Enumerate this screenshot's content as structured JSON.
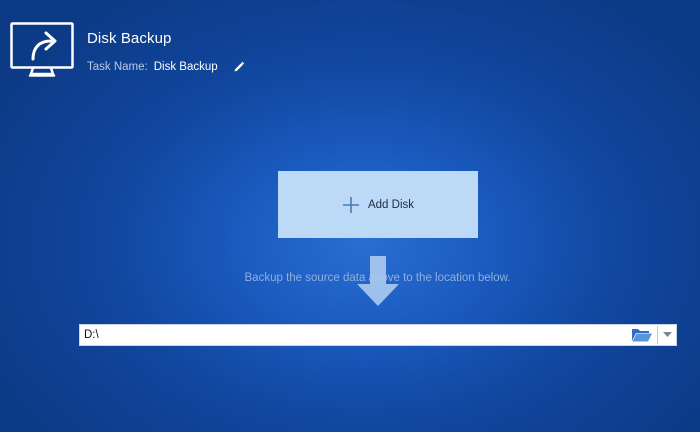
{
  "header": {
    "title": "Disk Backup",
    "task_label": "Task Name:",
    "task_value": "Disk Backup",
    "icon": "backup-monitor-icon",
    "edit_icon": "pencil-icon"
  },
  "source": {
    "add_label": "Add Disk",
    "icon": "plus-icon"
  },
  "hint": "Backup the source data above to the location below.",
  "destination": {
    "path": "D:\\",
    "folder_icon": "folder-open-icon",
    "dropdown_icon": "chevron-down-icon"
  },
  "colors": {
    "background": "#1b5cc1",
    "add_box": "#bcd9f8",
    "arrow": "#a9c9ef",
    "folder": "#2f6ec4"
  }
}
